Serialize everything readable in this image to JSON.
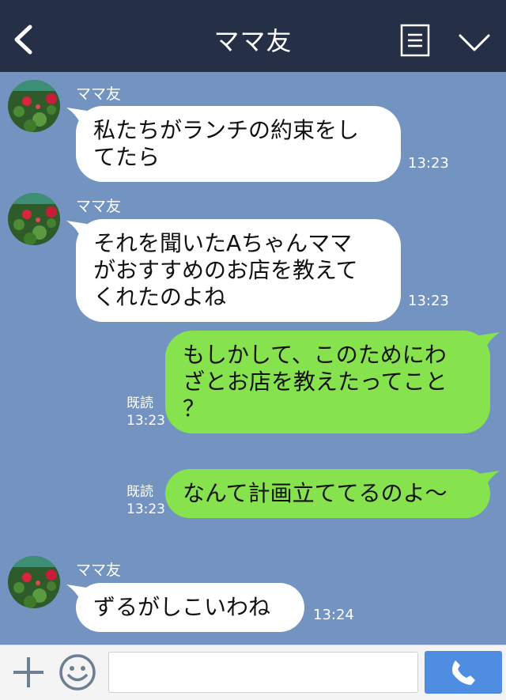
{
  "header": {
    "title": "ママ友",
    "back_icon": "chevron-left-icon",
    "menu_icon": "menu-icon",
    "collapse_icon": "chevron-down-icon"
  },
  "messages": [
    {
      "side": "in",
      "sender": "ママ友",
      "lines": [
        "私たちがランチの約束をし",
        "てたら"
      ],
      "time": "13:23"
    },
    {
      "side": "in",
      "sender": "ママ友",
      "lines": [
        "それを聞いたAちゃんママ",
        "がおすすめのお店を教えて",
        "くれたのよね"
      ],
      "time": "13:23"
    },
    {
      "side": "out",
      "lines": [
        "もしかして、このためにわ",
        "ざとお店を教えたってこと",
        "？"
      ],
      "read": "既読",
      "time": "13:23"
    },
    {
      "side": "out",
      "lines": [
        "なんて計画立ててるのよ～"
      ],
      "read": "既読",
      "time": "13:23"
    },
    {
      "side": "in",
      "sender": "ママ友",
      "lines": [
        "ずるがしこいわね"
      ],
      "time": "13:24"
    }
  ],
  "footer": {
    "input_value": "",
    "input_placeholder": "",
    "plus_icon": "plus-icon",
    "sticker_icon": "smile-icon",
    "call_icon": "phone-icon"
  },
  "colors": {
    "header": "#253047",
    "background": "#7393c0",
    "incoming_bubble": "#ffffff",
    "outgoing_bubble": "#86e34d",
    "send_button": "#4f8de0"
  }
}
